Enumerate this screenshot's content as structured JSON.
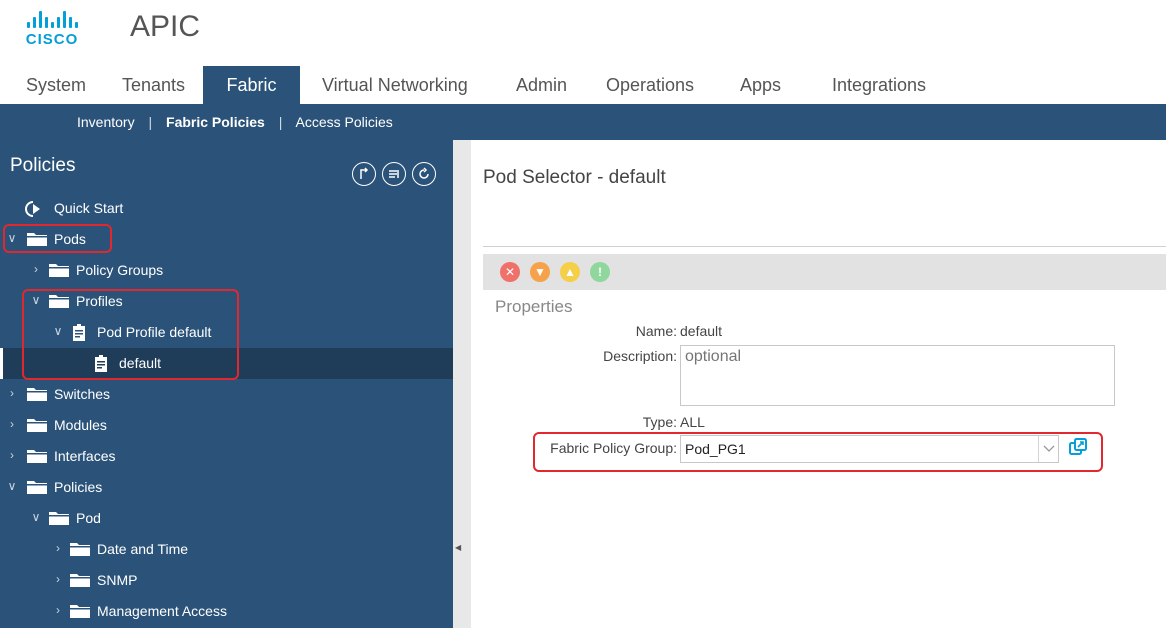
{
  "brand": {
    "logo_text": "CISCO",
    "app_title": "APIC",
    "accent": "#049fd9"
  },
  "tabs": [
    "System",
    "Tenants",
    "Fabric",
    "Virtual Networking",
    "Admin",
    "Operations",
    "Apps",
    "Integrations"
  ],
  "active_tab": "Fabric",
  "subnav": {
    "inventory": "Inventory",
    "fabric_policies": "Fabric Policies",
    "access_policies": "Access Policies",
    "separator": "|"
  },
  "sidebar": {
    "title": "Policies",
    "icons": [
      "step-icon",
      "list-icon",
      "refresh-icon"
    ],
    "items": [
      {
        "label": "Quick Start",
        "icon": "quick-start-icon"
      },
      {
        "label": "Pods",
        "icon": "folder-icon"
      },
      {
        "label": "Policy Groups",
        "icon": "folder-icon"
      },
      {
        "label": "Profiles",
        "icon": "folder-icon"
      },
      {
        "label": "Pod Profile default",
        "icon": "document-icon"
      },
      {
        "label": "default",
        "icon": "document-icon"
      },
      {
        "label": "Switches",
        "icon": "folder-icon"
      },
      {
        "label": "Modules",
        "icon": "folder-icon"
      },
      {
        "label": "Interfaces",
        "icon": "folder-icon"
      },
      {
        "label": "Policies",
        "icon": "folder-icon"
      },
      {
        "label": "Pod",
        "icon": "folder-icon"
      },
      {
        "label": "Date and Time",
        "icon": "folder-icon"
      },
      {
        "label": "SNMP",
        "icon": "folder-icon"
      },
      {
        "label": "Management Access",
        "icon": "folder-icon"
      }
    ],
    "bg": "#2b5379",
    "selected_bg": "#1f3c59",
    "highlight": "#e0282e"
  },
  "content": {
    "title": "Pod Selector - default",
    "faults": [
      {
        "icon": "critical-fault-icon",
        "color": "#f0706a"
      },
      {
        "icon": "major-fault-icon",
        "color": "#f5a24a"
      },
      {
        "icon": "minor-fault-icon",
        "color": "#f5cf48"
      },
      {
        "icon": "warning-fault-icon",
        "color": "#8fd79c"
      }
    ],
    "section": "Properties",
    "name_label": "Name:",
    "name_value": "default",
    "description_label": "Description:",
    "description_placeholder": "optional",
    "type_label": "Type:",
    "type_value": "ALL",
    "fpg_label": "Fabric Policy Group:",
    "fpg_value": "Pod_PG1"
  }
}
